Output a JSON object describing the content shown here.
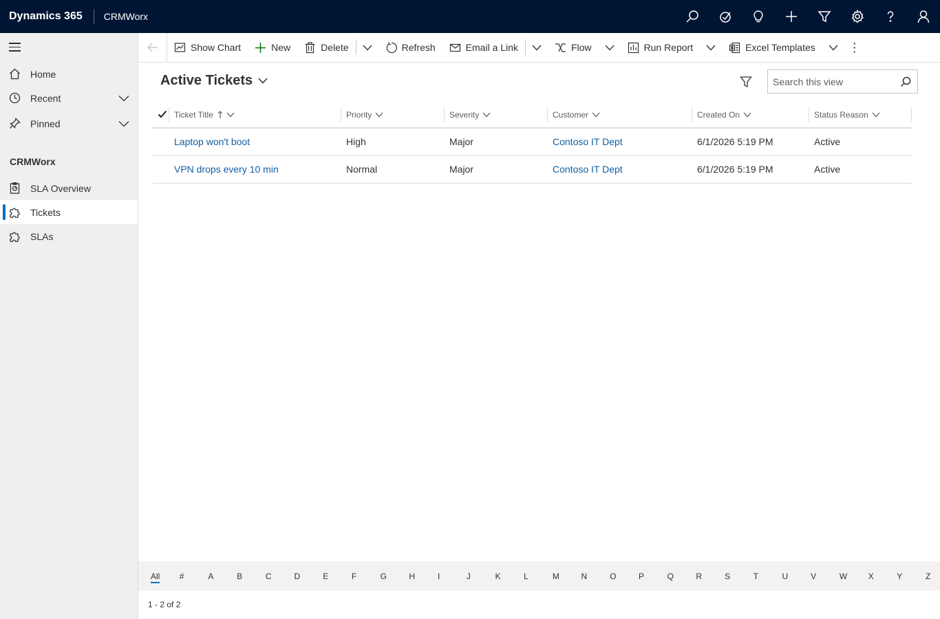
{
  "header": {
    "brand": "Dynamics 365",
    "app_name": "CRMWorx",
    "icons": [
      "search-icon",
      "task-icon",
      "lightbulb-icon",
      "plus-icon",
      "filter-icon",
      "gear-icon",
      "help-icon",
      "user-icon"
    ]
  },
  "sidebar": {
    "items": [
      {
        "label": "Home",
        "icon": "home-icon"
      },
      {
        "label": "Recent",
        "icon": "clock-icon"
      },
      {
        "label": "Pinned",
        "icon": "pin-icon"
      }
    ],
    "group_title": "CRMWorx",
    "group_items": [
      {
        "label": "SLA Overview",
        "icon": "dashboard-icon"
      },
      {
        "label": "Tickets",
        "icon": "puzzle-icon",
        "active": true
      },
      {
        "label": "SLAs",
        "icon": "puzzle-icon"
      }
    ]
  },
  "commands": {
    "show_chart": "Show Chart",
    "new": "New",
    "delete": "Delete",
    "refresh": "Refresh",
    "email_link": "Email a Link",
    "flow": "Flow",
    "run_report": "Run Report",
    "excel_templates": "Excel Templates",
    "more": "⋮"
  },
  "view": {
    "title": "Active Tickets",
    "search_placeholder": "Search this view"
  },
  "grid": {
    "columns": [
      "Ticket Title",
      "Priority",
      "Severity",
      "Customer",
      "Created On",
      "Status Reason"
    ],
    "rows": [
      {
        "title": "Laptop won't boot",
        "priority": "High",
        "severity": "Major",
        "customer": "Contoso IT Dept",
        "created_on": "6/1/2026 5:19 PM",
        "status": "Active"
      },
      {
        "title": "VPN drops every 10 min",
        "priority": "Normal",
        "severity": "Major",
        "customer": "Contoso IT Dept",
        "created_on": "6/1/2026 5:19 PM",
        "status": "Active"
      }
    ]
  },
  "jumpbar": [
    "All",
    "#",
    "A",
    "B",
    "C",
    "D",
    "E",
    "F",
    "G",
    "H",
    "I",
    "J",
    "K",
    "L",
    "M",
    "N",
    "O",
    "P",
    "Q",
    "R",
    "S",
    "T",
    "U",
    "V",
    "W",
    "X",
    "Y",
    "Z"
  ],
  "footer": {
    "record_count": "1 - 2 of 2"
  },
  "colors": {
    "topbar": "#001533",
    "accent": "#0f6cbd",
    "link": "#115ea3",
    "new_icon": "#107c10"
  }
}
